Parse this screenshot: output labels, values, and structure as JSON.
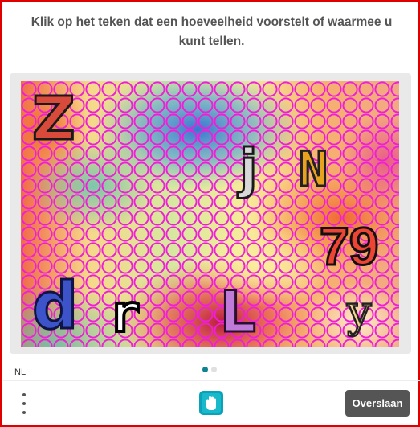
{
  "prompt": {
    "line1": "Klik op het teken dat een hoeveelheid voorstelt of waarmee u",
    "line2": "kunt tellen."
  },
  "challenge": {
    "glyphs": [
      {
        "id": "Z",
        "text": "Z",
        "fill": "#d94a3a",
        "stroke": "#1a1a1a"
      },
      {
        "id": "j",
        "text": "j",
        "fill": "#d8d8d8",
        "stroke": "#1a1a1a"
      },
      {
        "id": "N",
        "text": "N",
        "fill": "#e8a21e",
        "stroke": "#222222"
      },
      {
        "id": "79",
        "text": "79",
        "fill": "#ee4433",
        "stroke": "#111111"
      },
      {
        "id": "d",
        "text": "d",
        "fill": "#3c53c9",
        "stroke": "#0f1540"
      },
      {
        "id": "r",
        "text": "r",
        "fill": "#ffffff",
        "stroke": "#000000"
      },
      {
        "id": "L",
        "text": "L",
        "fill": "#c07ad8",
        "stroke": "#2a1030"
      },
      {
        "id": "y",
        "text": "y",
        "fill": "#f2d48a",
        "stroke": "#222222"
      }
    ],
    "ring_color": "#ee1fd6"
  },
  "footer": {
    "language": "NL",
    "skip_label": "Overslaan",
    "pages": 2,
    "active_page": 1
  },
  "colors": {
    "frame": "#e00000",
    "accent": "#0f8390",
    "button": "#555555"
  },
  "icons": {
    "menu": "vertical-dots-icon",
    "logo": "hcaptcha-hand-icon"
  }
}
